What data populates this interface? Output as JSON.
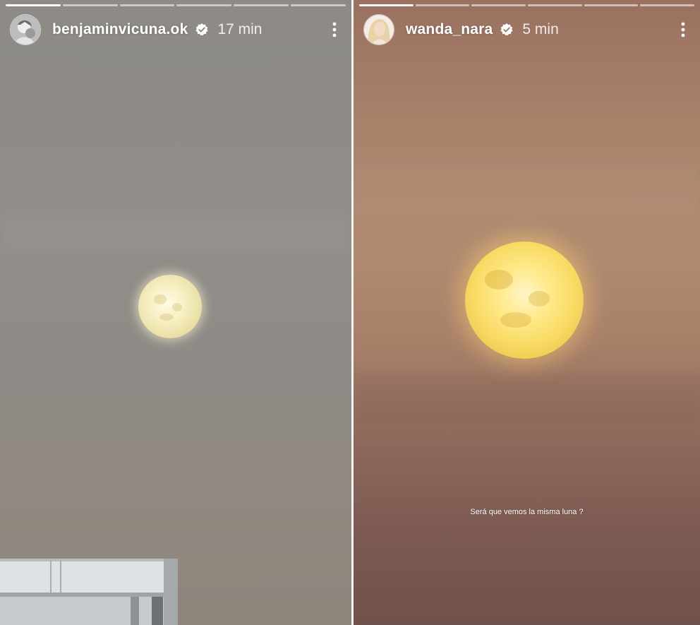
{
  "stories": [
    {
      "username": "benjaminvicuna.ok",
      "time": "17 min",
      "verified": true,
      "progress_segments": 6,
      "active_segment": 0,
      "avatar_icon": "avatar-face-icon",
      "caption": ""
    },
    {
      "username": "wanda_nara",
      "time": "5 min",
      "verified": true,
      "progress_segments": 6,
      "active_segment": 0,
      "avatar_icon": "avatar-face-icon",
      "caption": "Será que vemos la misma luna ?"
    }
  ],
  "colors": {
    "verified_badge": "#ffffff",
    "text": "#ffffff",
    "left_sky": "#8e8b87",
    "right_sky": "#a8826b"
  },
  "icons": {
    "verified": "verified-check-icon",
    "more": "more-vertical-icon"
  }
}
